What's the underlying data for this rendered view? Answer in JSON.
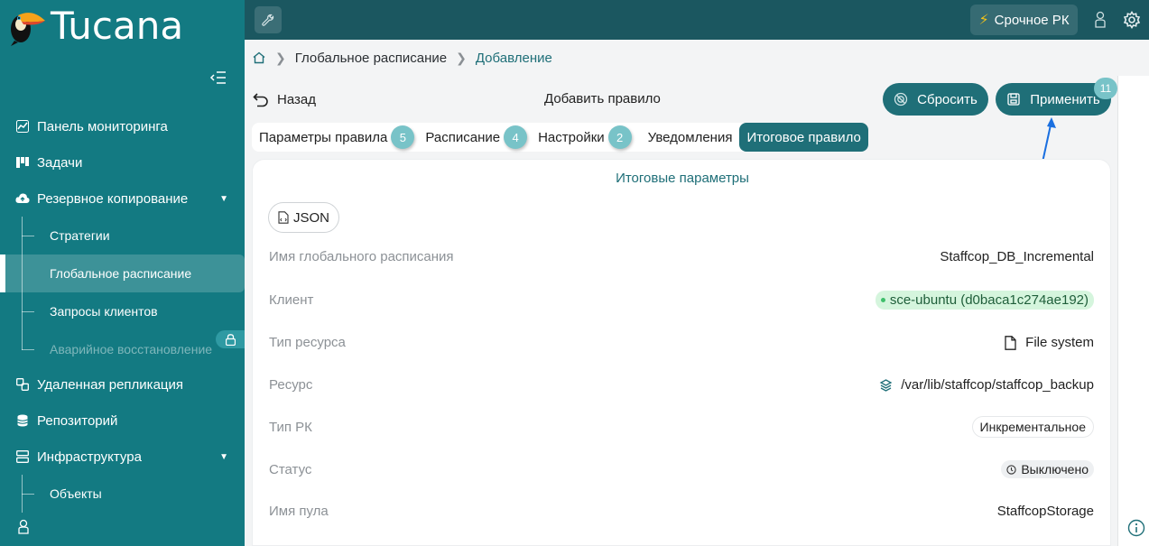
{
  "app": {
    "name": "Tucana"
  },
  "colors": {
    "sidebar": "#137a82",
    "topbar": "#1b5760",
    "accent": "#1f6f78",
    "badge": "#78c3c8"
  },
  "sidebar": {
    "items": [
      {
        "label": "Панель мониторинга",
        "icon": "chart-icon"
      },
      {
        "label": "Задачи",
        "icon": "tasks-icon"
      },
      {
        "label": "Резервное копирование",
        "icon": "cloud-backup-icon",
        "expanded": true,
        "children": [
          {
            "label": "Стратегии"
          },
          {
            "label": "Глобальное расписание",
            "active": true
          },
          {
            "label": "Запросы клиентов"
          },
          {
            "label": "Аварийное восстановление",
            "locked": true
          }
        ]
      },
      {
        "label": "Удаленная репликация",
        "icon": "replication-icon"
      },
      {
        "label": "Репозиторий",
        "icon": "database-icon"
      },
      {
        "label": "Инфраструктура",
        "icon": "server-icon",
        "expanded": true,
        "children": [
          {
            "label": "Объекты"
          }
        ]
      }
    ]
  },
  "topbar": {
    "urgent_label": "Срочное РК"
  },
  "breadcrumb": {
    "items": [
      "Глобальное расписание",
      "Добавление"
    ]
  },
  "toolbar": {
    "back_label": "Назад",
    "title": "Добавить правило",
    "reset_label": "Сбросить",
    "apply_label": "Применить",
    "apply_count": "11"
  },
  "tabs": [
    {
      "label": "Параметры правила",
      "badge": "5"
    },
    {
      "label": "Расписание",
      "badge": "4"
    },
    {
      "label": "Настройки",
      "badge": "2"
    },
    {
      "label": "Уведомления",
      "badge": ""
    },
    {
      "label": "Итоговое правило",
      "badge": "",
      "active": true
    }
  ],
  "summary": {
    "title": "Итоговые параметры",
    "json_label": "JSON",
    "rows": [
      {
        "label": "Имя глобального расписания",
        "value": "Staffcop_DB_Incremental"
      },
      {
        "label": "Клиент",
        "value": "sce-ubuntu (d0baca1c274ae192)"
      },
      {
        "label": "Тип ресурса",
        "value": "File system",
        "icon": "file-icon"
      },
      {
        "label": "Ресурс",
        "value": "/var/lib/staffcop/staffcop_backup",
        "icon": "layers-icon"
      },
      {
        "label": "Тип РК",
        "value": "Инкрементальное"
      },
      {
        "label": "Статус",
        "value": "Выключено",
        "icon": "clock-icon"
      },
      {
        "label": "Имя пула",
        "value": "StaffcopStorage"
      }
    ]
  }
}
